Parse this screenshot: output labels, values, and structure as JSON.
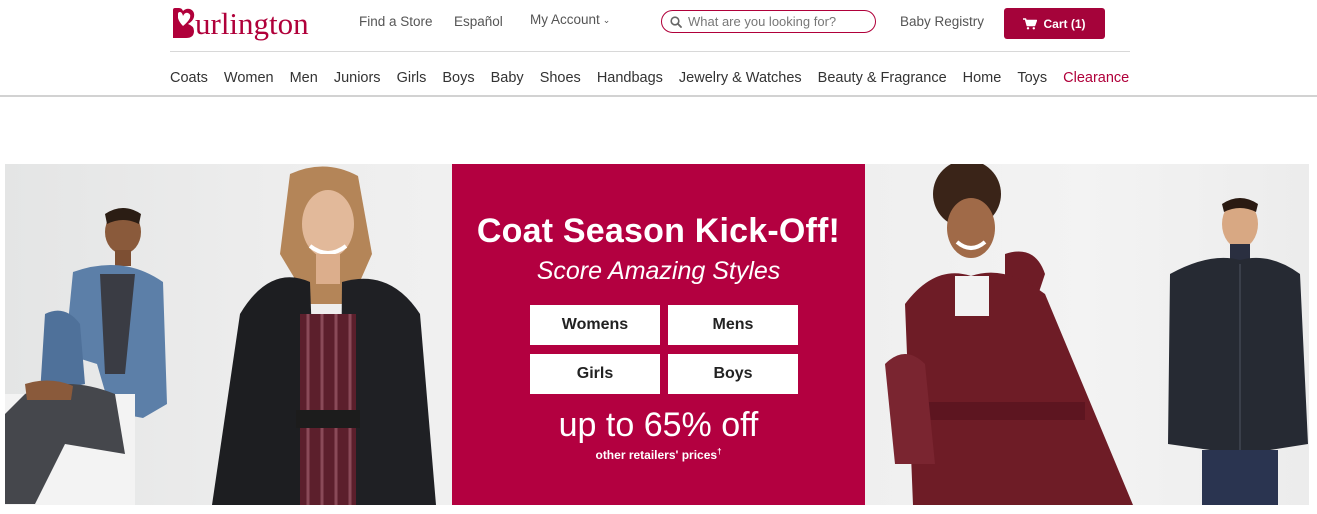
{
  "brand": {
    "logo_text": "urlington",
    "logo_letter": "B",
    "brand_color": "#b0003a"
  },
  "header": {
    "find_store": "Find a Store",
    "espanol": "Español",
    "my_account": "My Account",
    "baby_registry": "Baby Registry",
    "search_placeholder": "What are you looking for?",
    "cart_label": "Cart (1)"
  },
  "categories": [
    "Coats",
    "Women",
    "Men",
    "Juniors",
    "Girls",
    "Boys",
    "Baby",
    "Shoes",
    "Handbags",
    "Jewelry & Watches",
    "Beauty & Fragrance",
    "Home",
    "Toys",
    "Clearance"
  ],
  "hero": {
    "title": "Coat Season Kick-Off!",
    "subtitle": "Score Amazing Styles",
    "buttons": [
      "Womens",
      "Mens",
      "Girls",
      "Boys"
    ],
    "discount": "up to 65% off",
    "fine_print": "other retailers' prices",
    "fine_print_mark": "†",
    "panel_color": "#b30040"
  },
  "icons": {
    "search": "search-icon",
    "cart": "cart-icon",
    "chevron": "chevron-down-icon",
    "logo_heart": "heart-logo-icon"
  }
}
